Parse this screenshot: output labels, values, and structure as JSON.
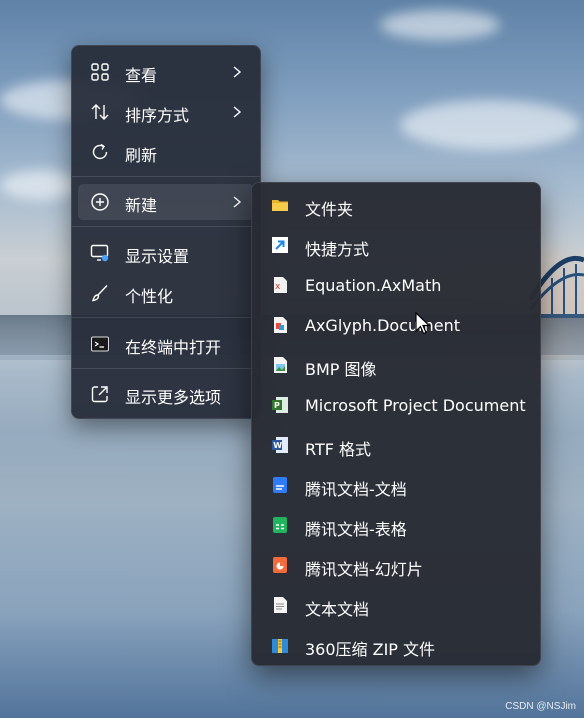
{
  "main_menu": {
    "items": [
      {
        "label": "查看",
        "icon": "grid-view-icon",
        "submenu": true
      },
      {
        "label": "排序方式",
        "icon": "sort-arrows-icon",
        "submenu": true
      },
      {
        "label": "刷新",
        "icon": "refresh-icon",
        "submenu": false
      },
      {
        "label": "新建",
        "icon": "add-circle-icon",
        "submenu": true,
        "active": true
      },
      {
        "label": "显示设置",
        "icon": "display-settings-icon",
        "submenu": false
      },
      {
        "label": "个性化",
        "icon": "paintbrush-icon",
        "submenu": false
      },
      {
        "label": "在终端中打开",
        "icon": "terminal-icon",
        "submenu": false
      },
      {
        "label": "显示更多选项",
        "icon": "open-external-icon",
        "submenu": false
      }
    ]
  },
  "new_submenu": {
    "items": [
      {
        "label": "文件夹",
        "icon": "folder-icon"
      },
      {
        "label": "快捷方式",
        "icon": "shortcut-icon"
      },
      {
        "label": "Equation.AxMath",
        "icon": "axmath-icon"
      },
      {
        "label": "AxGlyph.Document",
        "icon": "axglyph-icon"
      },
      {
        "label": "BMP 图像",
        "icon": "bmp-image-icon"
      },
      {
        "label": "Microsoft Project Document",
        "icon": "ms-project-icon"
      },
      {
        "label": "RTF 格式",
        "icon": "word-rtf-icon"
      },
      {
        "label": "腾讯文档-文档",
        "icon": "tencent-doc-icon"
      },
      {
        "label": "腾讯文档-表格",
        "icon": "tencent-sheet-icon"
      },
      {
        "label": "腾讯文档-幻灯片",
        "icon": "tencent-slides-icon"
      },
      {
        "label": "文本文档",
        "icon": "text-document-icon"
      },
      {
        "label": "360压缩 ZIP 文件",
        "icon": "zip-archive-icon"
      }
    ]
  },
  "watermark": "CSDN @NSJim",
  "colors": {
    "menu_bg": "#262c38",
    "accent_folder": "#f4c542",
    "shortcut_blue": "#1e88e5"
  }
}
